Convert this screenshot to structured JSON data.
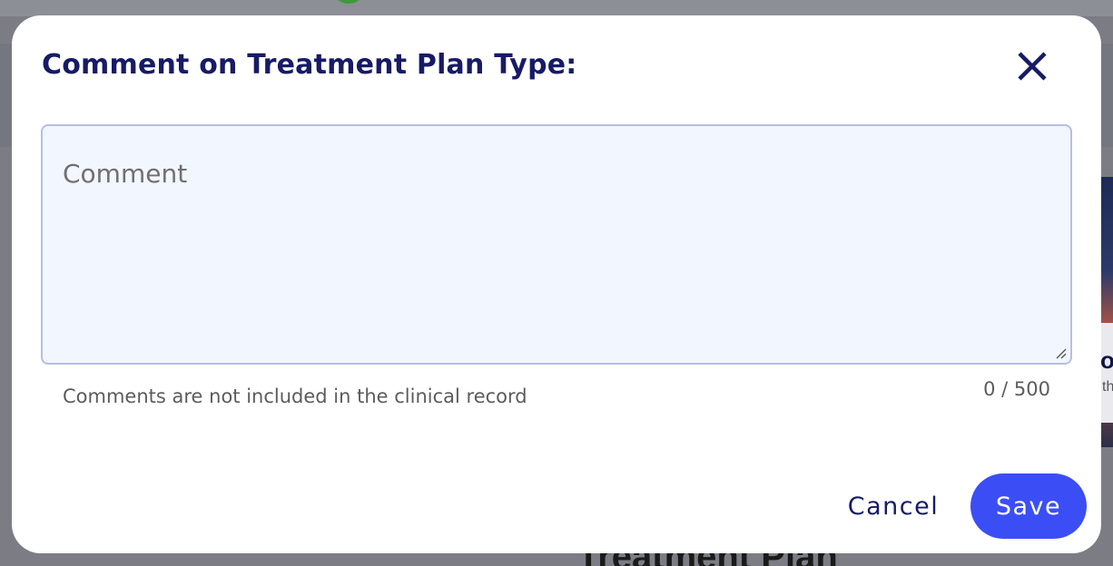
{
  "background": {
    "partial_heading": "Treatment Plan",
    "card_text": "o",
    "card_subtext": "th"
  },
  "dialog": {
    "title": "Comment on Treatment Plan Type:",
    "close_icon": "close-icon",
    "comment": {
      "placeholder": "Comment",
      "value": "",
      "helper": "Comments are not included in the clinical record",
      "counter": "0 / 500"
    },
    "actions": {
      "cancel_label": "Cancel",
      "save_label": "Save"
    }
  },
  "colors": {
    "title": "#171b66",
    "accent": "#3b4ef5",
    "input_background": "#f2f6ff",
    "input_border": "#b9bde2"
  }
}
